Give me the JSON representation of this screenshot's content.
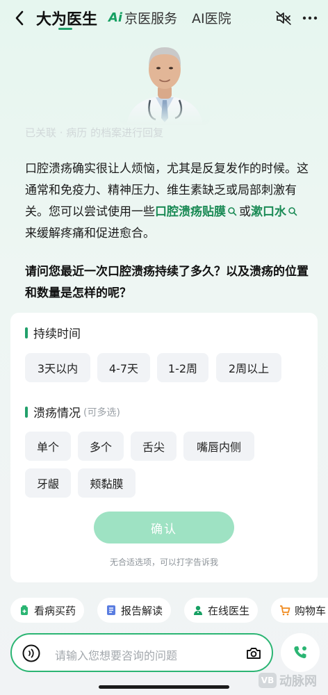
{
  "header": {
    "tab_active": "大为医生",
    "tab_jd_prefix": "Ai",
    "tab_jd": "京医服务",
    "tab_ai": "AI医院"
  },
  "hint": "已关联 · 病历 的档案进行回复",
  "answer": {
    "p1": "口腔溃疡确实很让人烦恼，尤其是反复发作的时候。这通常和免疫力、精神压力、维生素缺乏或局部刺激有关。您可以尝试使用一些",
    "kw1": "口腔溃疡贴膜",
    "mid": "或",
    "kw2": "漱口水",
    "tail": "来缓解疼痛和促进愈合。"
  },
  "question": "请问您最近一次口腔溃疡持续了多久？以及溃疡的位置和数量是怎样的呢？",
  "card": {
    "duration_title": "持续时间",
    "duration_options": [
      "3天以内",
      "4-7天",
      "1-2周",
      "2周以上"
    ],
    "condition_title": "溃疡情况",
    "condition_sub": "(可多选)",
    "condition_options": [
      "单个",
      "多个",
      "舌尖",
      "嘴唇内侧",
      "牙龈",
      "颊黏膜"
    ],
    "confirm": "确认",
    "tip": "无合适选项，可以打字告诉我"
  },
  "quick_actions": [
    "看病买药",
    "报告解读",
    "在线医生",
    "购物车"
  ],
  "input": {
    "placeholder": "请输入您想要咨询的问题"
  },
  "watermark": "动脉网",
  "colors": {
    "accent": "#22a06b",
    "confirm_disabled": "#9ee2c3",
    "chip_bg": "#f1f3f6"
  }
}
